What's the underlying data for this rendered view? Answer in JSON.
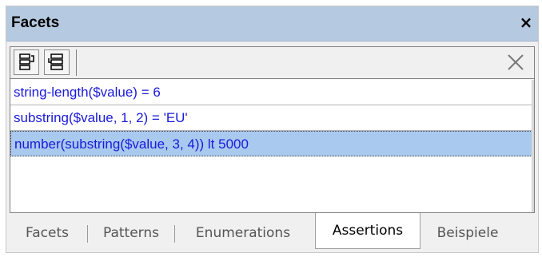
{
  "window": {
    "title": "Facets",
    "close_label": "×"
  },
  "toolbar": {
    "icons": [
      "insert-before-icon",
      "append-icon",
      "delete-icon"
    ]
  },
  "assertions": [
    "string-length($value) = 6",
    "substring($value, 1, 2) = 'EU'",
    "number(substring($value, 3, 4)) lt 5000"
  ],
  "selected_index": 2,
  "tabs": [
    {
      "label": "Facets",
      "active": false
    },
    {
      "label": "Patterns",
      "active": false
    },
    {
      "label": "Enumerations",
      "active": false
    },
    {
      "label": "Assertions",
      "active": true
    },
    {
      "label": "Beispiele",
      "active": false
    }
  ],
  "colors": {
    "titlebar": "#b5c9e0",
    "row_text": "#1a1adb",
    "selection": "#a9c9ee"
  }
}
